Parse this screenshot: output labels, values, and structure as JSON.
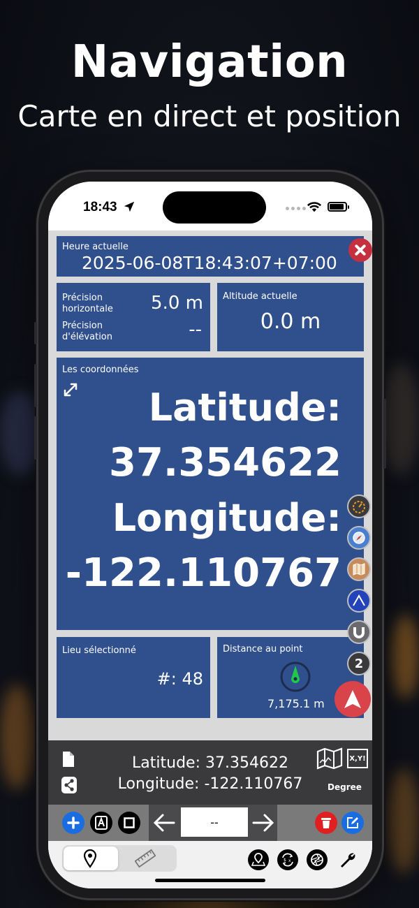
{
  "promo": {
    "title": "Navigation",
    "subtitle": "Carte en direct et position"
  },
  "status_bar": {
    "time": "18:43"
  },
  "panels": {
    "current_time": {
      "label": "Heure actuelle",
      "value": "2025-06-08T18:43:07+07:00"
    },
    "precision": {
      "horizontal_label_1": "Précision",
      "horizontal_label_2": "horizontale",
      "horizontal_value": "5.0 m",
      "elevation_label_1": "Précision",
      "elevation_label_2": "d'élévation",
      "elevation_value": "--"
    },
    "altitude": {
      "label": "Altitude actuelle",
      "value": "0.0 m"
    },
    "coordinates": {
      "label": "Les coordonnées",
      "lat_label": "Latitude:",
      "lat_value": "37.354622",
      "lon_label": "Longitude:",
      "lon_value": "-122.110767"
    },
    "selected_place": {
      "label": "Lieu sélectionné",
      "value": "#: 48"
    },
    "distance": {
      "label": "Distance au point",
      "value": "7,175.1 m"
    }
  },
  "side_buttons": {
    "badge_number": "2"
  },
  "info_bar": {
    "latitude_line": "Latitude: 37.354622",
    "longitude_line": "Longitude: -122.110767",
    "format_label": "Degree",
    "xy_label": "X,Y!"
  },
  "toolbar": {
    "point_field": "--"
  },
  "colors": {
    "panel_blue": "#304f8d",
    "close_red": "#c62f3f",
    "nav_red": "#d9434a",
    "add_blue": "#1a6de0",
    "delete_red": "#e02020",
    "compass_green": "#22c84a"
  }
}
